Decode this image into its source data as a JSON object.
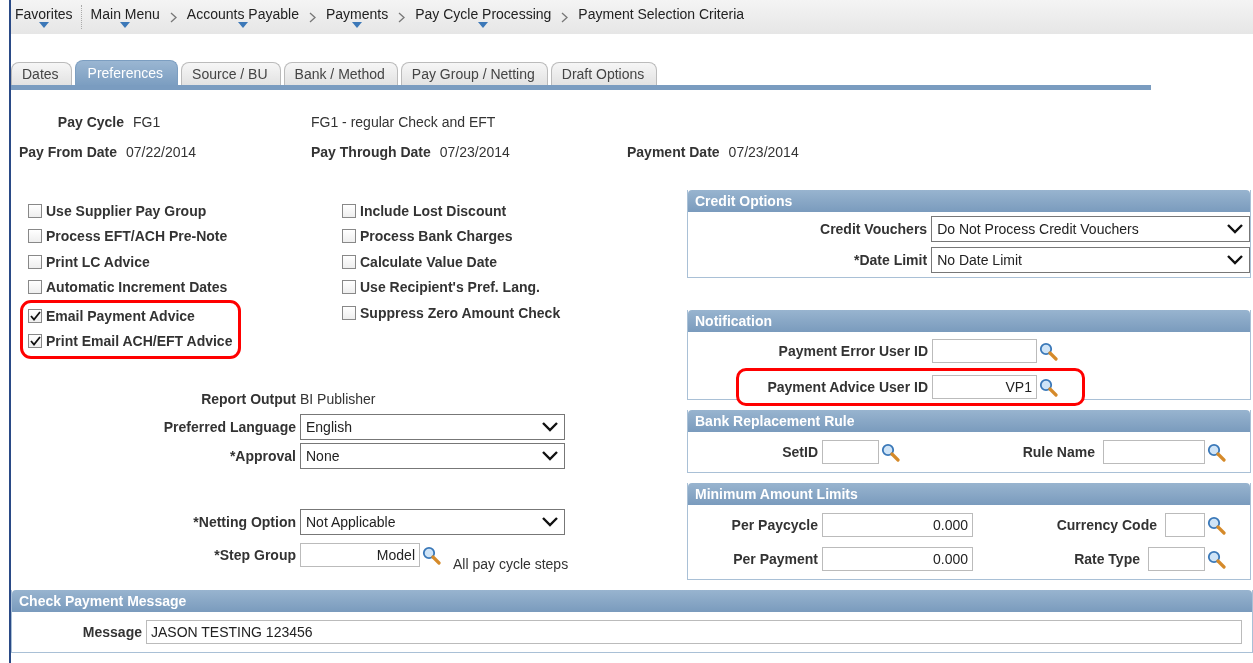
{
  "breadcrumb": [
    {
      "label": "Favorites",
      "has_menu": true
    },
    {
      "label": "Main Menu",
      "has_menu": true
    },
    {
      "label": "Accounts Payable",
      "has_menu": true
    },
    {
      "label": "Payments",
      "has_menu": true
    },
    {
      "label": "Pay Cycle Processing",
      "has_menu": true
    },
    {
      "label": "Payment Selection Criteria",
      "has_menu": false
    }
  ],
  "tabs": [
    {
      "label": "Dates",
      "selected": false
    },
    {
      "label": "Preferences",
      "selected": true
    },
    {
      "label": "Source / BU",
      "selected": false
    },
    {
      "label": "Bank / Method",
      "selected": false
    },
    {
      "label": "Pay Group / Netting",
      "selected": false
    },
    {
      "label": "Draft Options",
      "selected": false
    }
  ],
  "header": {
    "pay_cycle": {
      "label": "Pay Cycle",
      "value": "FG1"
    },
    "description": "FG1 - regular Check and EFT",
    "dates": [
      {
        "label": "Pay From Date",
        "value": "07/22/2014"
      },
      {
        "label": "Pay Through Date",
        "value": "07/23/2014"
      },
      {
        "label": "Payment Date",
        "value": "07/23/2014"
      }
    ]
  },
  "options_left": [
    {
      "label": "Use Supplier Pay Group",
      "checked": false,
      "highlighted": false
    },
    {
      "label": "Process EFT/ACH Pre-Note",
      "checked": false,
      "highlighted": false
    },
    {
      "label": "Print LC Advice",
      "checked": false,
      "highlighted": false
    },
    {
      "label": "Automatic Increment Dates",
      "checked": false,
      "highlighted": false
    },
    {
      "label": "Email Payment Advice",
      "checked": true,
      "highlighted": true
    },
    {
      "label": "Print Email ACH/EFT Advice",
      "checked": true,
      "highlighted": true
    }
  ],
  "options_right": [
    {
      "label": "Include Lost Discount",
      "checked": false,
      "highlighted": false
    },
    {
      "label": "Process Bank Charges",
      "checked": false,
      "highlighted": false
    },
    {
      "label": "Calculate Value Date",
      "checked": false,
      "highlighted": false
    },
    {
      "label": "Use Recipient's Pref. Lang.",
      "checked": false,
      "highlighted": false
    },
    {
      "label": "Suppress Zero Amount Check",
      "checked": false,
      "highlighted": false
    }
  ],
  "output_fields": [
    {
      "kind": "display",
      "label": "Report Output",
      "value": "BI Publisher"
    },
    {
      "kind": "select",
      "label": "Preferred Language",
      "value": "English"
    },
    {
      "kind": "select",
      "label": "*Approval",
      "value": "None"
    }
  ],
  "netting_fields": [
    {
      "kind": "select",
      "label": "*Netting Option",
      "value": "Not Applicable"
    },
    {
      "kind": "lookup",
      "label": "*Step Group",
      "value": "Model",
      "description": "All pay cycle steps"
    }
  ],
  "credit_options": {
    "title": "Credit Options",
    "fields": [
      {
        "kind": "select",
        "label": "Credit Vouchers",
        "value": "Do Not Process Credit Vouchers"
      },
      {
        "kind": "select",
        "label": "*Date Limit",
        "value": "No Date Limit"
      }
    ]
  },
  "notification": {
    "title": "Notification",
    "fields": [
      {
        "kind": "lookup",
        "label": "Payment Error User ID",
        "highlighted": false
      },
      {
        "kind": "lookup",
        "label": "Payment Advice User ID",
        "value": "VP1",
        "highlighted": true
      }
    ]
  },
  "bank_replacement_rule": {
    "title": "Bank Replacement Rule",
    "fields": [
      {
        "kind": "lookup",
        "label": "SetID"
      },
      {
        "kind": "lookup",
        "label": "Rule Name"
      }
    ]
  },
  "minimum_amount_limits": {
    "title": "Minimum Amount Limits",
    "fields": [
      {
        "kind": "number",
        "label": "Per Paycycle",
        "value": "0.000"
      },
      {
        "kind": "lookup",
        "label": "Currency Code"
      },
      {
        "kind": "number",
        "label": "Per Payment",
        "value": "0.000"
      },
      {
        "kind": "lookup",
        "label": "Rate Type"
      }
    ]
  },
  "check_payment_message": {
    "title": "Check Payment Message",
    "fields": [
      {
        "kind": "text",
        "label": "Message",
        "value": "JASON TESTING 123456"
      }
    ]
  }
}
